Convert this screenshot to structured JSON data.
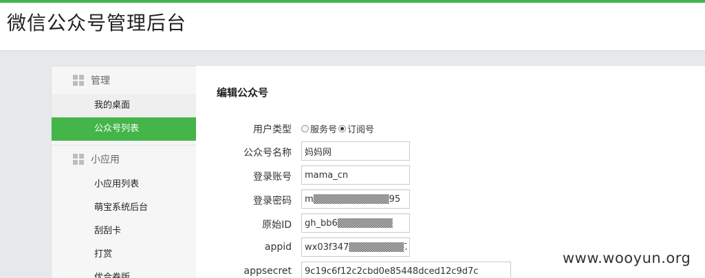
{
  "header": {
    "title": "微信公众号管理后台"
  },
  "sidebar": {
    "sections": [
      {
        "title": "管理",
        "icon": "grid-icon",
        "items": [
          {
            "label": "我的桌面"
          },
          {
            "label": "公众号列表",
            "active": true
          }
        ]
      },
      {
        "title": "小应用",
        "icon": "grid-icon",
        "items": [
          {
            "label": "小应用列表"
          },
          {
            "label": "萌宝系统后台"
          },
          {
            "label": "刮刮卡"
          },
          {
            "label": "打赏"
          },
          {
            "label": "优合券版"
          }
        ]
      }
    ]
  },
  "main": {
    "title": "编辑公众号",
    "form": {
      "user_type": {
        "label": "用户类型",
        "options": [
          "服务号",
          "订阅号"
        ],
        "selected": "订阅号"
      },
      "name": {
        "label": "公众号名称",
        "value": "妈妈网"
      },
      "account": {
        "label": "登录账号",
        "value": "mama_cn"
      },
      "password": {
        "label": "登录密码",
        "value": "m▒▒▒▒▒▒▒▒▒▒▒95"
      },
      "original_id": {
        "label": "原始ID",
        "value": "gh_bb6▒▒▒▒▒▒▒▒"
      },
      "appid": {
        "label": "appid",
        "value": "wx03f347▒▒▒▒▒▒▒▒7"
      },
      "appsecret": {
        "label": "appsecret",
        "value": "9c19c6f12c2cbd0e85448dced12c9d7c"
      }
    }
  },
  "watermark": "www.wooyun.org",
  "colors": {
    "accent": "#44b549",
    "background": "#e7e8eb"
  }
}
